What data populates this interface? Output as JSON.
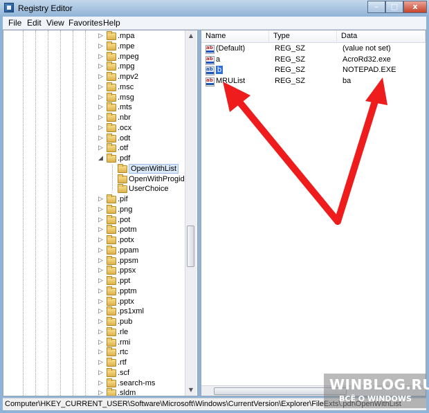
{
  "window": {
    "title": "Registry Editor",
    "min_label": "–",
    "max_label": "□",
    "close_label": "x"
  },
  "menu": [
    "File",
    "Edit",
    "View",
    "Favorites",
    "Help"
  ],
  "tree": {
    "items_before": [
      ".mpa",
      ".mpe",
      ".mpeg",
      ".mpg",
      ".mpv2",
      ".msc",
      ".msg",
      ".mts",
      ".nbr",
      ".ocx",
      ".odt",
      ".otf"
    ],
    "expanded": ".pdf",
    "children": [
      "OpenWithList",
      "OpenWithProgids",
      "UserChoice"
    ],
    "selected_child": "OpenWithList",
    "items_after": [
      ".pif",
      ".png",
      ".pot",
      ".potm",
      ".potx",
      ".ppam",
      ".ppsm",
      ".ppsx",
      ".ppt",
      ".pptm",
      ".pptx",
      ".ps1xml",
      ".pub",
      ".rle",
      ".rmi",
      ".rtc",
      ".rtf",
      ".scf",
      ".search-ms",
      ".sldm"
    ]
  },
  "values": {
    "headers": {
      "name": "Name",
      "type": "Type",
      "data": "Data"
    },
    "rows": [
      {
        "name": "(Default)",
        "type": "REG_SZ",
        "data": "(value not set)",
        "icon": "string-value-icon",
        "selected": false
      },
      {
        "name": "a",
        "type": "REG_SZ",
        "data": "AcroRd32.exe",
        "icon": "string-value-icon",
        "selected": false
      },
      {
        "name": "b",
        "type": "REG_SZ",
        "data": "NOTEPAD.EXE",
        "icon": "string-value-icon",
        "selected": true
      },
      {
        "name": "MRUList",
        "type": "REG_SZ",
        "data": "ba",
        "icon": "string-value-icon",
        "selected": false
      }
    ]
  },
  "status": "Computer\\HKEY_CURRENT_USER\\Software\\Microsoft\\Windows\\CurrentVersion\\Explorer\\FileExts\\.pdf\\OpenWithList",
  "watermark": {
    "top": "WINBLOG.RU",
    "bottom": "ВСЁ О WINDOWS"
  },
  "annotation_color": "#ee1c1c"
}
